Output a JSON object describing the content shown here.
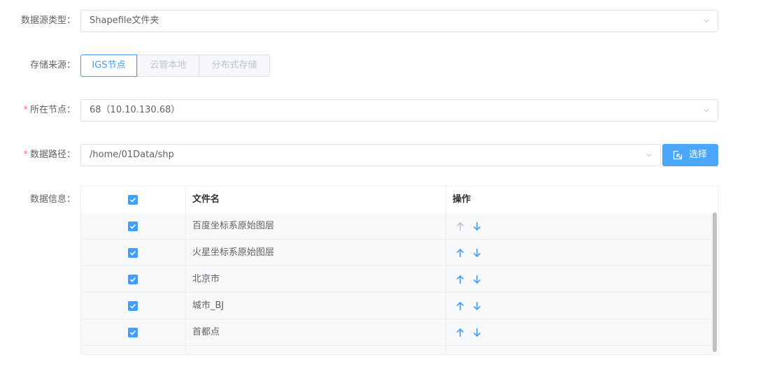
{
  "form": {
    "data_source_type": {
      "label": "数据源类型：",
      "value": "Shapefile文件夹"
    },
    "storage_source": {
      "label": "存储来源：",
      "options": [
        "IGS节点",
        "云管本地",
        "分布式存储"
      ],
      "selected": "IGS节点"
    },
    "node": {
      "required_mark": "*",
      "label": "所在节点：",
      "value": "68（10.10.130.68）"
    },
    "data_path": {
      "required_mark": "*",
      "label": "数据路径：",
      "value": "/home/01Data/shp",
      "select_button": "选择"
    },
    "data_info": {
      "label": "数据信息："
    }
  },
  "table": {
    "headers": {
      "filename": "文件名",
      "action": "操作"
    },
    "rows": [
      {
        "name": "百度坐标系原始图层",
        "checked": true,
        "up_enabled": false,
        "down_enabled": true
      },
      {
        "name": "火星坐标系原始图层",
        "checked": true,
        "up_enabled": true,
        "down_enabled": true
      },
      {
        "name": "北京市",
        "checked": true,
        "up_enabled": true,
        "down_enabled": true
      },
      {
        "name": "城市_BJ",
        "checked": true,
        "up_enabled": true,
        "down_enabled": true
      },
      {
        "name": "首都点",
        "checked": true,
        "up_enabled": true,
        "down_enabled": true
      }
    ]
  },
  "colors": {
    "primary": "#409eff",
    "button": "#4ba7fb",
    "required": "#f56c6c",
    "disabled_arrow": "#c0c4cc"
  },
  "icons": {
    "chevron": "chevron-down-icon",
    "select_button": "select-file-icon",
    "up": "arrow-up-icon",
    "down": "arrow-down-icon",
    "check": "check-icon"
  }
}
